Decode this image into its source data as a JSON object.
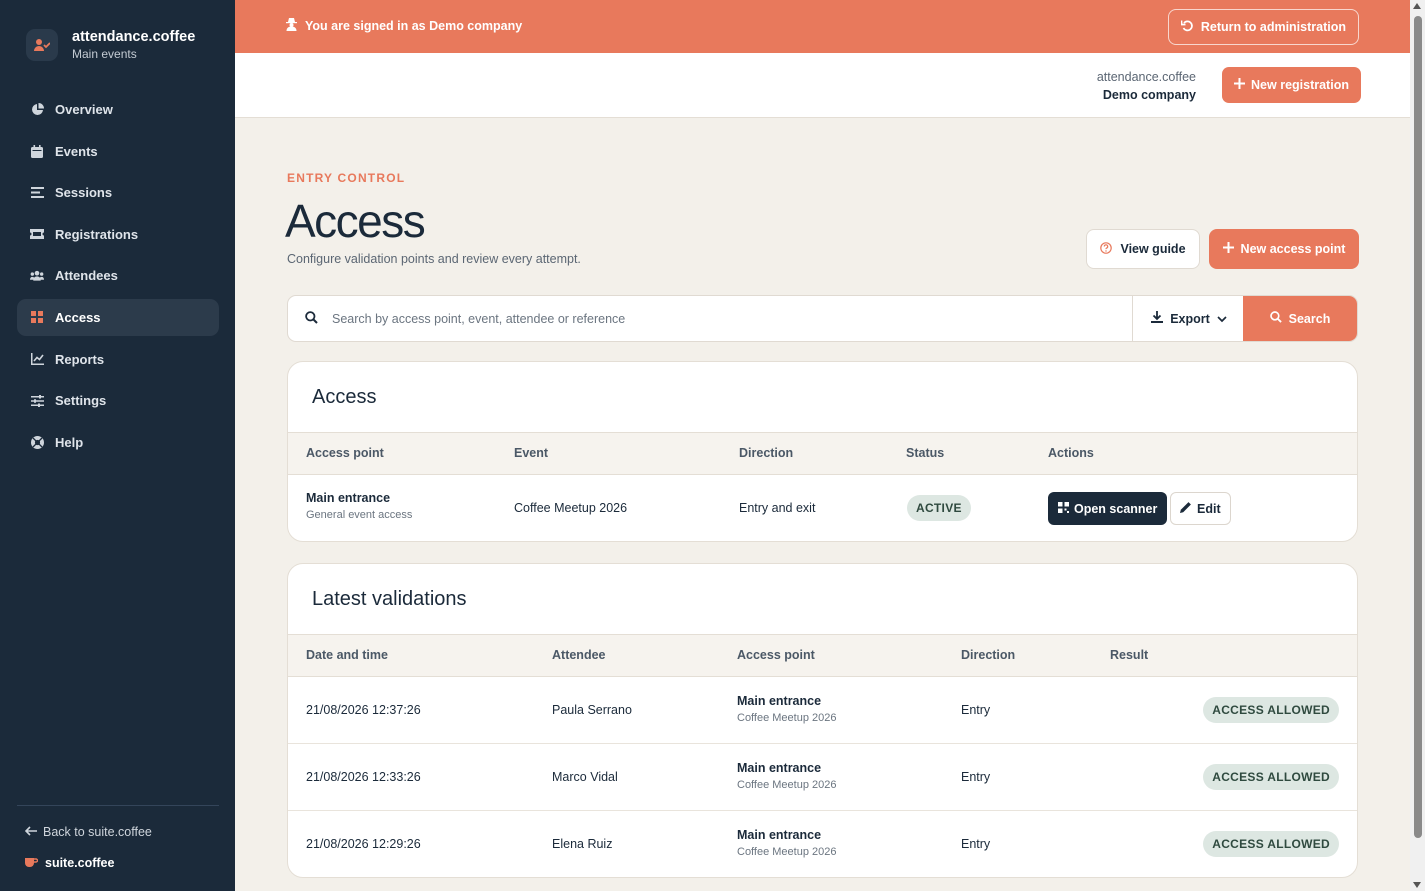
{
  "brand": {
    "title": "attendance.coffee",
    "subtitle": "Main events"
  },
  "sidebar": {
    "items": [
      {
        "label": "Overview",
        "icon": "pie-chart-icon"
      },
      {
        "label": "Events",
        "icon": "calendar-icon"
      },
      {
        "label": "Sessions",
        "icon": "list-icon"
      },
      {
        "label": "Registrations",
        "icon": "ticket-icon"
      },
      {
        "label": "Attendees",
        "icon": "users-icon"
      },
      {
        "label": "Access",
        "icon": "grid-icon",
        "active": true
      },
      {
        "label": "Reports",
        "icon": "chart-icon"
      },
      {
        "label": "Settings",
        "icon": "sliders-icon"
      },
      {
        "label": "Help",
        "icon": "help-icon"
      }
    ],
    "back_label": "Back to suite.coffee",
    "suite_label": "suite.coffee"
  },
  "banner": {
    "text": "You are signed in as Demo company",
    "return_label": "Return to administration"
  },
  "topbar": {
    "app": "attendance.coffee",
    "company": "Demo company",
    "new_registration": "New registration"
  },
  "page": {
    "eyebrow": "ENTRY CONTROL",
    "title": "Access",
    "description": "Configure validation points and review every attempt.",
    "guide_label": "View guide",
    "new_access_label": "New access point"
  },
  "search": {
    "placeholder": "Search by access point, event, attendee or reference",
    "export_label": "Export",
    "search_label": "Search"
  },
  "access_card": {
    "title": "Access",
    "headers": [
      "Access point",
      "Event",
      "Direction",
      "Status",
      "Actions"
    ],
    "rows": [
      {
        "name": "Main entrance",
        "sub": "General event access",
        "event": "Coffee Meetup 2026",
        "direction": "Entry and exit",
        "status": "ACTIVE",
        "open_label": "Open scanner",
        "edit_label": "Edit"
      }
    ]
  },
  "validations_card": {
    "title": "Latest validations",
    "headers": [
      "Date and time",
      "Attendee",
      "Access point",
      "Direction",
      "Result"
    ],
    "rows": [
      {
        "datetime": "21/08/2026 12:37:26",
        "attendee": "Paula Serrano",
        "point": "Main entrance",
        "event": "Coffee Meetup 2026",
        "direction": "Entry",
        "result": "ACCESS ALLOWED"
      },
      {
        "datetime": "21/08/2026 12:33:26",
        "attendee": "Marco Vidal",
        "point": "Main entrance",
        "event": "Coffee Meetup 2026",
        "direction": "Entry",
        "result": "ACCESS ALLOWED"
      },
      {
        "datetime": "21/08/2026 12:29:26",
        "attendee": "Elena Ruiz",
        "point": "Main entrance",
        "event": "Coffee Meetup 2026",
        "direction": "Entry",
        "result": "ACCESS ALLOWED"
      }
    ]
  },
  "colors": {
    "accent": "#e8795c",
    "sidebar": "#1b2a3a",
    "background": "#f3f0ea",
    "badge": "#dde7e2"
  }
}
